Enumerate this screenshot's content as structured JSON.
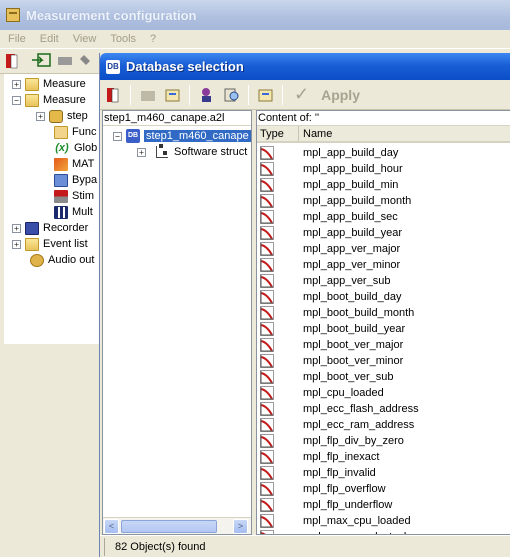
{
  "background_window": {
    "title": "Measurement configuration",
    "menu": [
      "File",
      "Edit",
      "View",
      "Tools",
      "?"
    ],
    "tree": [
      {
        "label": "Measure",
        "expander": "+",
        "icon": "folder-icon"
      },
      {
        "label": "Measure",
        "expander": "−",
        "icon": "folder-open-icon"
      },
      {
        "label": "step",
        "expander": "+",
        "icon": "device-icon"
      },
      {
        "label": "Func",
        "expander": "",
        "icon": "function-icon"
      },
      {
        "label": "Glob",
        "expander": "",
        "icon": "fx-icon"
      },
      {
        "label": "MAT",
        "expander": "",
        "icon": "matlab-icon"
      },
      {
        "label": "Bypa",
        "expander": "",
        "icon": "bypass-icon"
      },
      {
        "label": "Stim",
        "expander": "",
        "icon": "stimulation-icon"
      },
      {
        "label": "Mult",
        "expander": "",
        "icon": "multimedia-icon"
      },
      {
        "label": "Recorder",
        "expander": "+",
        "icon": "disk-icon"
      },
      {
        "label": "Event list",
        "expander": "+",
        "icon": "event-list-icon"
      },
      {
        "label": "Audio out",
        "expander": "",
        "icon": "speaker-icon"
      }
    ],
    "fx_glyph": "(x)"
  },
  "dialog": {
    "title": "Database selection",
    "title_badge": "DB",
    "toolbar": {
      "apply_label": "Apply",
      "apply_glyph": "✓"
    },
    "left_pane": {
      "path": "step1_m460_canape.a2l",
      "root_node": "step1_m460_canape",
      "root_badge": "DB",
      "child_node": "Software struct",
      "expander_root": "−",
      "expander_child": "+",
      "scroll_left": "<",
      "scroll_right": ">"
    },
    "right_pane": {
      "content_header": "Content of: ''",
      "col_type": "Type",
      "col_name": "Name",
      "rows": [
        "mpl_app_build_day",
        "mpl_app_build_hour",
        "mpl_app_build_min",
        "mpl_app_build_month",
        "mpl_app_build_sec",
        "mpl_app_build_year",
        "mpl_app_ver_major",
        "mpl_app_ver_minor",
        "mpl_app_ver_sub",
        "mpl_boot_build_day",
        "mpl_boot_build_month",
        "mpl_boot_build_year",
        "mpl_boot_ver_major",
        "mpl_boot_ver_minor",
        "mpl_boot_ver_sub",
        "mpl_cpu_loaded",
        "mpl_ecc_flash_address",
        "mpl_ecc_ram_address",
        "mpl_flp_div_by_zero",
        "mpl_flp_inexact",
        "mpl_flp_invalid",
        "mpl_flp_overflow",
        "mpl_flp_underflow",
        "mpl_max_cpu_loaded",
        "mpl_max_used_stack"
      ]
    },
    "status": "82 Object(s) found"
  },
  "colors": {
    "dialog_title_blue": "#1a5fd6",
    "selection_blue": "#316ac5",
    "measurement_icon_red": "#c41a1a"
  }
}
